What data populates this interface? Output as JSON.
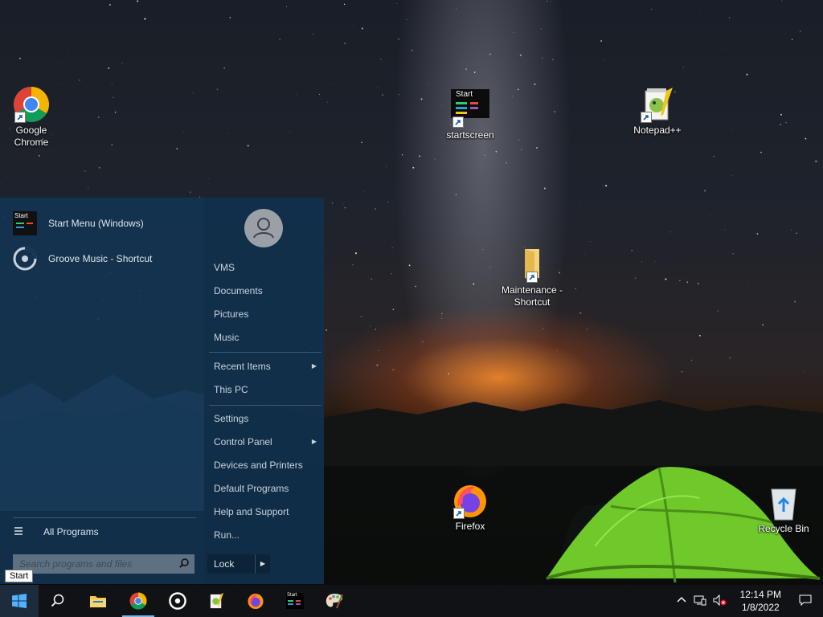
{
  "desktop": {
    "icons": [
      {
        "name": "google-chrome",
        "label": "Google Chrome"
      },
      {
        "name": "startscreen",
        "label": "startscreen",
        "badge": "Start"
      },
      {
        "name": "notepadpp",
        "label": "Notepad++"
      },
      {
        "name": "maintenance-shortcut",
        "label": "Maintenance - Shortcut"
      },
      {
        "name": "firefox",
        "label": "Firefox"
      },
      {
        "name": "recycle-bin",
        "label": "Recycle Bin"
      }
    ]
  },
  "start_menu": {
    "pinned": [
      {
        "label": "Start Menu (Windows)",
        "badge": "Start"
      },
      {
        "label": "Groove Music - Shortcut"
      }
    ],
    "all_programs": "All Programs",
    "search_placeholder": "Search programs and files",
    "right": {
      "items": [
        {
          "label": "VMS"
        },
        {
          "label": "Documents"
        },
        {
          "label": "Pictures"
        },
        {
          "label": "Music"
        },
        {
          "label": "Recent Items",
          "submenu": true
        },
        {
          "label": "This PC"
        },
        {
          "label": "Settings"
        },
        {
          "label": "Control Panel",
          "submenu": true
        },
        {
          "label": "Devices and Printers"
        },
        {
          "label": "Default Programs"
        },
        {
          "label": "Help and Support"
        },
        {
          "label": "Run..."
        }
      ],
      "lock_label": "Lock"
    }
  },
  "tooltip": "Start",
  "taskbar": {
    "apps": [
      "file-explorer",
      "chrome",
      "groove",
      "notepadpp",
      "firefox",
      "startscreen",
      "paint"
    ],
    "start_badge": "Start",
    "clock": {
      "time": "12:14 PM",
      "date": "1/8/2022"
    }
  },
  "colors": {
    "accent": "#7bb6e8",
    "start_menu": "#123452",
    "taskbar": "#101216"
  }
}
